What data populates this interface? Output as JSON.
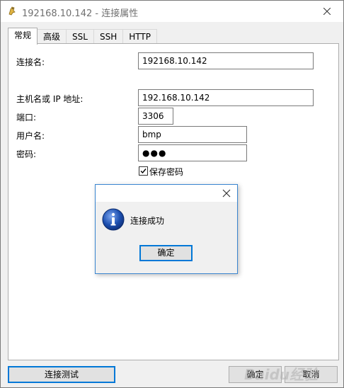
{
  "window": {
    "title": "192168.10.142 - 连接属性"
  },
  "tabs": [
    {
      "label": "常规",
      "active": true
    },
    {
      "label": "高级",
      "active": false
    },
    {
      "label": "SSL",
      "active": false
    },
    {
      "label": "SSH",
      "active": false
    },
    {
      "label": "HTTP",
      "active": false
    }
  ],
  "form": {
    "connection_name_label": "连接名:",
    "connection_name_value": "192168.10.142",
    "host_label": "主机名或 IP 地址:",
    "host_value": "192.168.10.142",
    "port_label": "端口:",
    "port_value": "3306",
    "username_label": "用户名:",
    "username_value": "bmp",
    "password_label": "密码:",
    "password_value": "●●●",
    "save_password_label": "保存密码",
    "save_password_checked": true
  },
  "dialog": {
    "message": "连接成功",
    "ok_label": "确定"
  },
  "footer": {
    "test_label": "连接测试",
    "ok_label": "确定",
    "cancel_label": "取消"
  },
  "watermark": "Baidu经验",
  "colors": {
    "accent": "#0078d7",
    "info_icon": "#1c4fb0"
  }
}
